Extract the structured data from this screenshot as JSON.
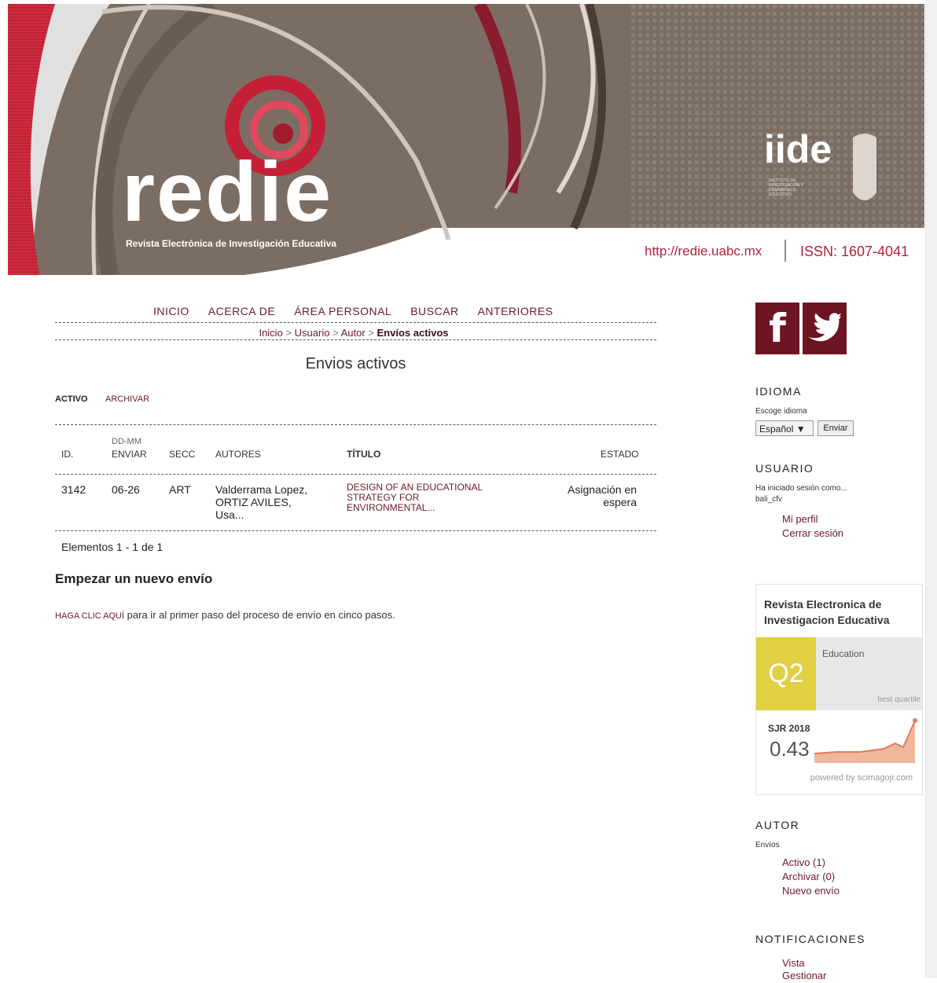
{
  "header": {
    "logo_word": "redie",
    "logo_subtitle": "Revista Electrónica de Investigación Educativa",
    "institute_logo": "iide",
    "institute_subtitle": "INSTITUTO DE INVESTIGACIÓN Y DESARROLLO EDUCATIVO",
    "url": "http://redie.uabc.mx",
    "issn": "ISSN: 1607-4041"
  },
  "nav": {
    "items": [
      "INICIO",
      "ACERCA DE",
      "ÁREA PERSONAL",
      "BUSCAR",
      "ANTERIORES"
    ]
  },
  "breadcrumb": {
    "home": "Inicio",
    "user": "Usuario",
    "author": "Autor",
    "current": "Envíos activos",
    "sep": ">"
  },
  "page_title": "Envios activos",
  "tabs": {
    "active": "ACTIVO",
    "archive": "ARCHIVAR"
  },
  "table": {
    "headers": {
      "id": "ID.",
      "date_top": "DD-MM",
      "date_bottom": "ENVIAR",
      "section": "SECC",
      "authors": "AUTORES",
      "title": "TÍTULO",
      "status": "ESTADO"
    },
    "rows": [
      {
        "id": "3142",
        "date": "06-26",
        "section": "ART",
        "authors_1": "Valderrama Lopez,",
        "authors_2": "ORTIZ AVILES,",
        "authors_3": "Usa...",
        "title_1": "DESIGN OF AN EDUCATIONAL",
        "title_2": "STRATEGY FOR",
        "title_3": "ENVIRONMENTAL...",
        "status_1": "Asignación en",
        "status_2": "espera"
      }
    ]
  },
  "pagination_info": "Elementos 1 - 1 de 1",
  "new_submission": {
    "heading": "Empezar un nuevo envío",
    "link": "HAGA CLIC AQUÍ",
    "text": "para ir al primer paso del proceso de envío en cinco pasos."
  },
  "sidebar": {
    "social": {
      "facebook": "f",
      "twitter": "twitter-bird"
    },
    "language": {
      "heading": "IDIOMA",
      "label": "Escoge idioma",
      "selected": "Español ▼",
      "button": "Enviar"
    },
    "user": {
      "heading": "USUARIO",
      "logged_as": "Ha iniciado sesión como...",
      "username": "bali_cfv",
      "profile": "Mi perfil",
      "logout": "Cerrar sesión"
    },
    "scimago": {
      "title_1": "Revista Electronica de",
      "title_2": "Investigacion Educativa",
      "quartile": "Q2",
      "category": "Education",
      "best": "best quartile",
      "sjr_label": "SJR 2018",
      "sjr_value": "0.43",
      "powered": "powered by scimagojr.com"
    },
    "author": {
      "heading": "AUTOR",
      "label": "Envíos",
      "active": "Activo (1)",
      "archive": "Archivar (0)",
      "new": "Nuevo envío"
    },
    "notifications": {
      "heading": "NOTIFICACIONES",
      "view": "Vista",
      "manage": "Gestionar"
    }
  },
  "colors": {
    "brand_dark": "#6d1522",
    "brand_red": "#b0223a",
    "header_brown": "#7a6c62",
    "quartile_yellow": "#e2cf42"
  }
}
